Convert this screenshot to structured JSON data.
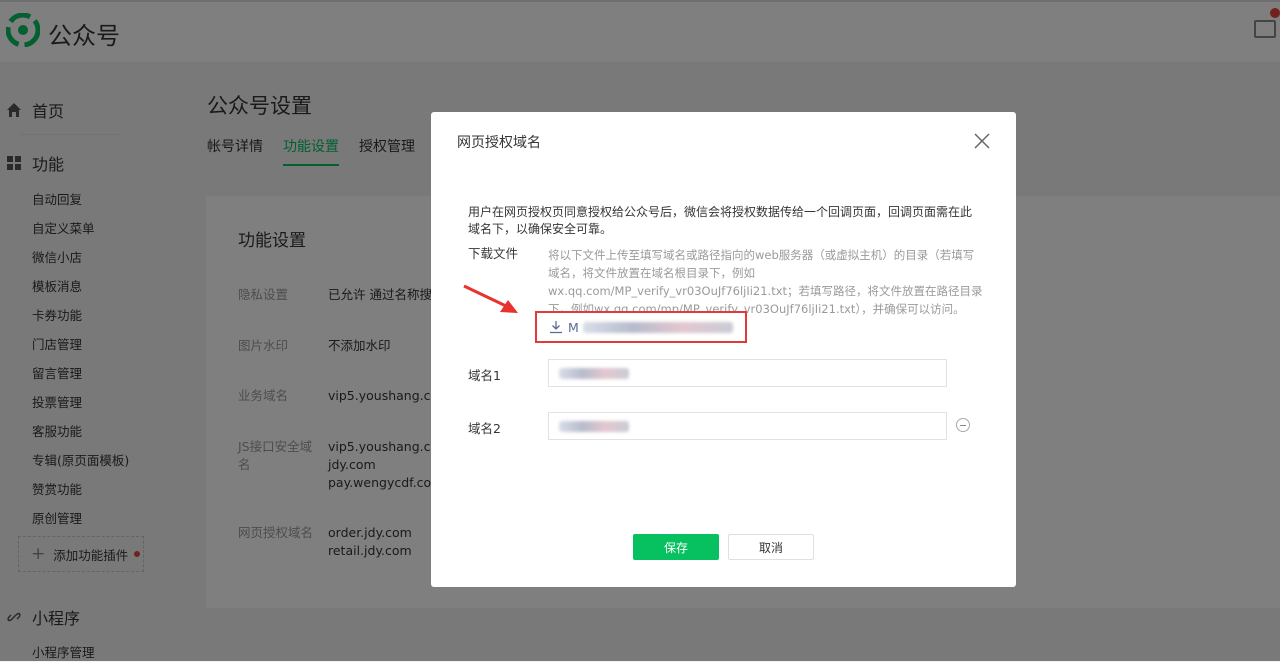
{
  "header": {
    "brand": "公众号"
  },
  "sidebar": {
    "home": "首页",
    "features": "功能",
    "feature_items": [
      "自动回复",
      "自定义菜单",
      "微信小店",
      "模板消息",
      "卡券功能",
      "门店管理",
      "留言管理",
      "投票管理",
      "客服功能",
      "专辑(原页面模板)",
      "赞赏功能",
      "原创管理"
    ],
    "add_plugin": "添加功能插件",
    "miniprogram": "小程序",
    "miniprogram_manage": "小程序管理"
  },
  "main": {
    "title": "公众号设置",
    "tabs": [
      "帐号详情",
      "功能设置",
      "授权管理"
    ],
    "card_title": "功能设置",
    "rows": [
      {
        "label": "隐私设置",
        "value": "已允许 通过名称搜索"
      },
      {
        "label": "图片水印",
        "value": "不添加水印"
      },
      {
        "label": "业务域名",
        "value": "vip5.youshang.com"
      },
      {
        "label": "JS接口安全域名",
        "value": "vip5.youshang.com\njdy.com\npay.wengycdf.com"
      },
      {
        "label": "网页授权域名",
        "value": "order.jdy.com\nretail.jdy.com"
      }
    ]
  },
  "dialog": {
    "title": "网页授权域名",
    "description": "用户在网页授权页同意授权给公众号后，微信会将授权数据传给一个回调页面，回调页面需在此域名下，以确保安全可靠。",
    "download_label": "下载文件",
    "download_hint": "将以下文件上传至填写域名或路径指向的web服务器（或虚拟主机）的目录（若填写域名，将文件放置在域名根目录下，例如wx.qq.com/MP_verify_vr03OuJf76ljIi21.txt；若填写路径，将文件放置在路径目录下，例如wx.qq.com/mp/MP_verify_vr03OuJf76ljIi21.txt），并确保可以访问。",
    "file_prefix": "M",
    "domain1_label": "域名1",
    "domain2_label": "域名2",
    "save": "保存",
    "cancel": "取消"
  },
  "colors": {
    "accent": "#07c160",
    "highlight": "#e03a3a"
  }
}
